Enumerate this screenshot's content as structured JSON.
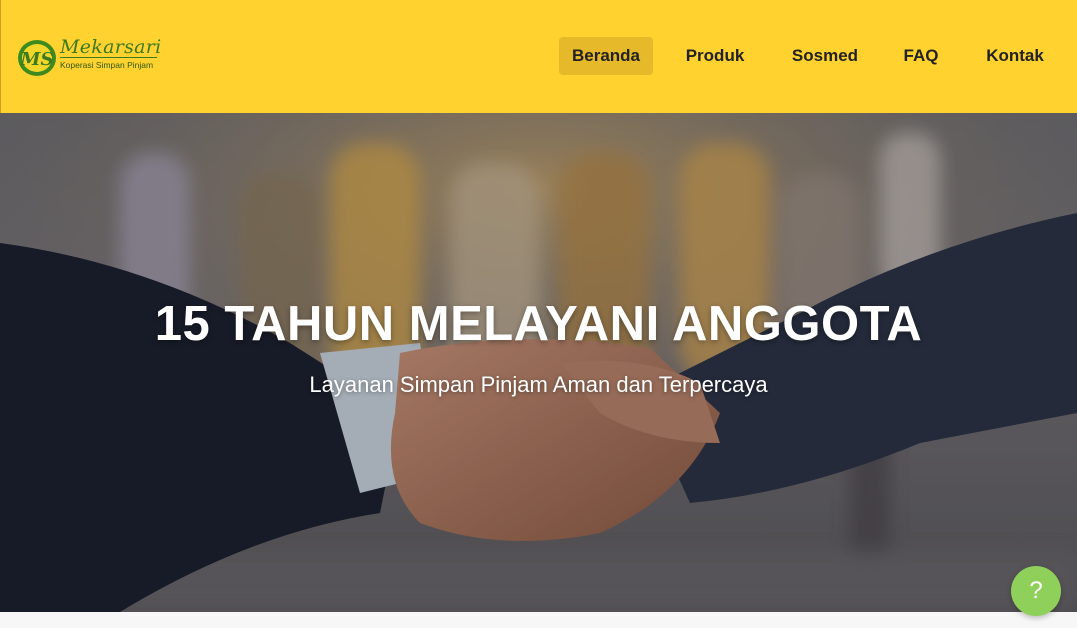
{
  "brand": {
    "logo_mark": "MS",
    "name": "Mekarsari",
    "tagline": "Koperasi Simpan Pinjam",
    "primary_color": "#ffd230",
    "accent_green": "#3b7a1e"
  },
  "nav": {
    "items": [
      {
        "label": "Beranda",
        "active": true
      },
      {
        "label": "Produk",
        "active": false
      },
      {
        "label": "Sosmed",
        "active": false
      },
      {
        "label": "FAQ",
        "active": false
      },
      {
        "label": "Kontak",
        "active": false
      }
    ]
  },
  "hero": {
    "title": "15 TAHUN MELAYANI ANGGOTA",
    "subtitle": "Layanan Simpan Pinjam Aman dan Terpercaya",
    "image": "handshake-photo"
  },
  "help": {
    "label": "?",
    "icon": "help-icon",
    "color": "#8fd05a"
  }
}
